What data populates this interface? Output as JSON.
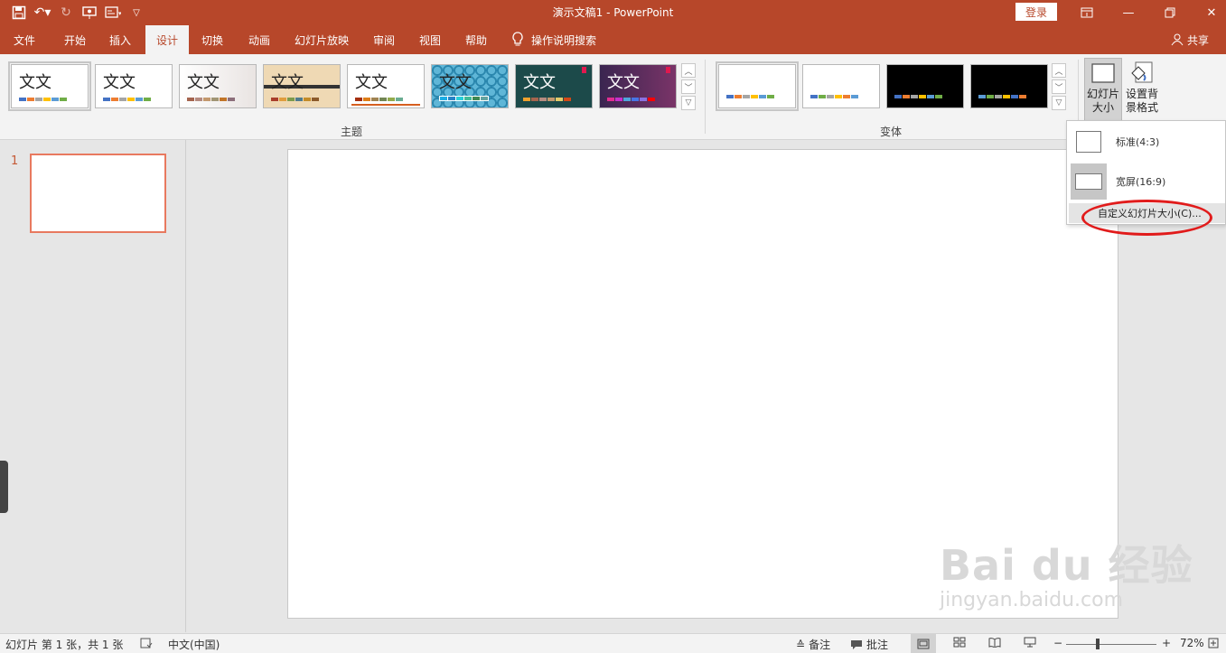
{
  "title_bar": {
    "title": "演示文稿1  -  PowerPoint",
    "login_label": "登录"
  },
  "tabs": [
    {
      "label": "文件"
    },
    {
      "label": "开始"
    },
    {
      "label": "插入"
    },
    {
      "label": "设计",
      "active": true
    },
    {
      "label": "切换"
    },
    {
      "label": "动画"
    },
    {
      "label": "幻灯片放映"
    },
    {
      "label": "审阅"
    },
    {
      "label": "视图"
    },
    {
      "label": "帮助"
    }
  ],
  "tell_me": "操作说明搜索",
  "share_label": "共享",
  "ribbon": {
    "themes_label": "主题",
    "variants_label": "变体",
    "theme_text": "文文",
    "slide_size_label_1": "幻灯片",
    "slide_size_label_2": "大小",
    "format_bg_label_1": "设置背",
    "format_bg_label_2": "景格式"
  },
  "slide_size_menu": {
    "standard": "标准(4:3)",
    "widescreen": "宽屏(16:9)",
    "custom": "自定义幻灯片大小(C)..."
  },
  "slide_panel": {
    "slide_number": "1"
  },
  "watermark": {
    "big": "Bai du 经验",
    "small": "jingyan.baidu.com"
  },
  "status_bar": {
    "slide_info": "幻灯片 第 1 张，共 1 张",
    "language": "中文(中国)",
    "notes": "备注",
    "comments": "批注",
    "zoom_minus": "−",
    "zoom_plus": "+",
    "zoom_value": "72%"
  },
  "colors": {
    "accent": "#b7472a",
    "ribbon_bg": "#f3f3f3",
    "annotation_red": "#e11b1b"
  }
}
